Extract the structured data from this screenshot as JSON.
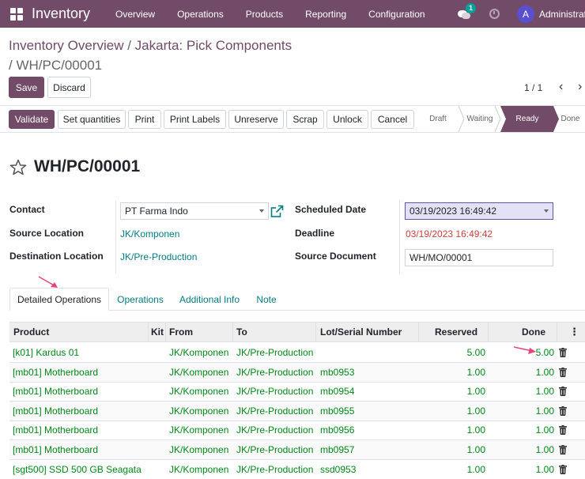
{
  "navbar": {
    "app_name": "Inventory",
    "menus": [
      "Overview",
      "Operations",
      "Products",
      "Reporting",
      "Configuration"
    ],
    "chat_badge": "1",
    "avatar_letter": "A",
    "user_name": "Administrator"
  },
  "breadcrumb": {
    "parent": "Inventory Overview",
    "sep": " / ",
    "picking_type": "Jakarta: Pick Components",
    "current": "/ WH/PC/00001"
  },
  "control": {
    "save_label": "Save",
    "discard_label": "Discard",
    "pager": "1 / 1"
  },
  "statusbar": {
    "buttons": [
      "Validate",
      "Set quantities",
      "Print",
      "Print Labels",
      "Unreserve",
      "Scrap",
      "Unlock",
      "Cancel"
    ],
    "stages": [
      "Draft",
      "Waiting",
      "Ready",
      "Done"
    ],
    "active_stage": "Ready"
  },
  "form": {
    "name": "WH/PC/00001",
    "contact_label": "Contact",
    "contact_value": "PT Farma Indo",
    "source_location_label": "Source Location",
    "source_location_value": "JK/Komponen",
    "destination_location_label": "Destination Location",
    "destination_location_value": "JK/Pre-Production",
    "scheduled_date_label": "Scheduled Date",
    "scheduled_date_value": "03/19/2023 16:49:42",
    "deadline_label": "Deadline",
    "deadline_value": "03/19/2023 16:49:42",
    "source_document_label": "Source Document",
    "source_document_value": "WH/MO/00001"
  },
  "tabs": [
    "Detailed Operations",
    "Operations",
    "Additional Info",
    "Note"
  ],
  "table": {
    "columns": [
      "Product",
      "Kit",
      "From",
      "To",
      "Lot/Serial Number",
      "Reserved",
      "Done"
    ],
    "options_icon": "⋮",
    "rows": [
      {
        "product": "[k01] Kardus 01",
        "from": "JK/Komponen",
        "to": "JK/Pre-Production",
        "lot": "",
        "reserved": "5.00",
        "done": "5.00"
      },
      {
        "product": "[mb01] Motherboard",
        "from": "JK/Komponen",
        "to": "JK/Pre-Production",
        "lot": "mb0953",
        "reserved": "1.00",
        "done": "1.00"
      },
      {
        "product": "[mb01] Motherboard",
        "from": "JK/Komponen",
        "to": "JK/Pre-Production",
        "lot": "mb0954",
        "reserved": "1.00",
        "done": "1.00"
      },
      {
        "product": "[mb01] Motherboard",
        "from": "JK/Komponen",
        "to": "JK/Pre-Production",
        "lot": "mb0955",
        "reserved": "1.00",
        "done": "1.00"
      },
      {
        "product": "[mb01] Motherboard",
        "from": "JK/Komponen",
        "to": "JK/Pre-Production",
        "lot": "mb0956",
        "reserved": "1.00",
        "done": "1.00"
      },
      {
        "product": "[mb01] Motherboard",
        "from": "JK/Komponen",
        "to": "JK/Pre-Production",
        "lot": "mb0957",
        "reserved": "1.00",
        "done": "1.00"
      },
      {
        "product": "[sgt500] SSD 500 GB Seagata",
        "from": "JK/Komponen",
        "to": "JK/Pre-Production",
        "lot": "ssd0953",
        "reserved": "1.00",
        "done": "1.00"
      }
    ]
  },
  "colors": {
    "brand": "#714b67",
    "link": "#017e84",
    "line_text": "#008818",
    "deadline": "#d23f3a",
    "annotation_arrow": "#e8447a"
  }
}
